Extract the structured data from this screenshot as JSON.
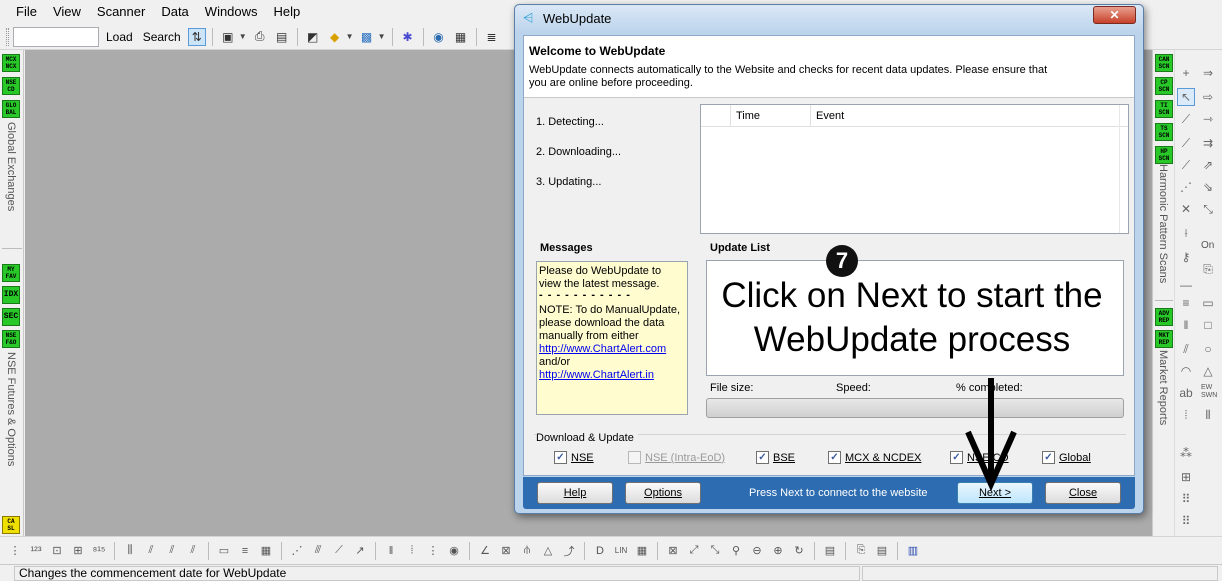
{
  "menu": [
    "File",
    "View",
    "Scanner",
    "Data",
    "Windows",
    "Help"
  ],
  "toolbar": {
    "search_value": "",
    "load_label": "Load",
    "search_label": "Search"
  },
  "left_sidebar": {
    "top_badges": [
      "MCX NCX",
      "NSE CD",
      "GLO BAL"
    ],
    "top_section_label": "Global Exchanges",
    "bottom_badges": [
      "MY FAV",
      "IDX",
      "SEC",
      "NSE F&O"
    ],
    "bottom_section_label": "NSE Futures & Options",
    "last_badge": "CA SL"
  },
  "right_strip": {
    "badges_top": [
      "CAN SCN",
      "CP SCN",
      "TI SCN",
      "TS SCN",
      "HP SCN"
    ],
    "label_top": "Harmonic Pattern Scans",
    "badges_bottom": [
      "ADV REP",
      "MKT REP"
    ],
    "label_bottom": "Market Reports"
  },
  "right_tools": {
    "on_label": "On",
    "ew_label": "EW SWN"
  },
  "dialog": {
    "title": "WebUpdate",
    "close_label": "✕",
    "welcome_title": "Welcome to WebUpdate",
    "welcome_text": "WebUpdate connects automatically to the Website and checks for recent data updates. Please ensure that you are online before proceeding.",
    "steps": [
      "1.  Detecting...",
      "2.  Downloading...",
      "3.  Updating..."
    ],
    "event_columns": [
      "Time",
      "Event"
    ],
    "messages_title": "Messages",
    "messages": {
      "line1": "Please do WebUpdate to view the latest message.",
      "dots": "- - - - - - - - - - -",
      "line2": "NOTE: To do ManualUpdate, please download the data manually from either",
      "link1": "http://www.ChartAlert.com",
      "and_or": "and/or",
      "link2": "http://www.ChartAlert.in"
    },
    "update_list_title": "Update List",
    "file_size_label": "File size:",
    "speed_label": "Speed:",
    "percent_label": "% completed:",
    "download_group_label": "Download & Update",
    "checkboxes": [
      {
        "label": "NSE",
        "checked": true,
        "enabled": true
      },
      {
        "label": "NSE (Intra-EoD)",
        "checked": false,
        "enabled": false
      },
      {
        "label": "BSE",
        "checked": true,
        "enabled": true
      },
      {
        "label": "MCX & NCDEX",
        "checked": true,
        "enabled": true
      },
      {
        "label": "NSE CD",
        "checked": true,
        "enabled": true
      },
      {
        "label": "Global",
        "checked": true,
        "enabled": true
      }
    ],
    "help_button": "Help",
    "options_button": "Options",
    "footer_text": "Press Next to connect to the website",
    "next_button": "Next >",
    "close_button": "Close"
  },
  "annotation": {
    "step_number": "7",
    "text": "Click on Next to start the WebUpdate process"
  },
  "status": {
    "message": "Changes the commencement date for WebUpdate"
  }
}
